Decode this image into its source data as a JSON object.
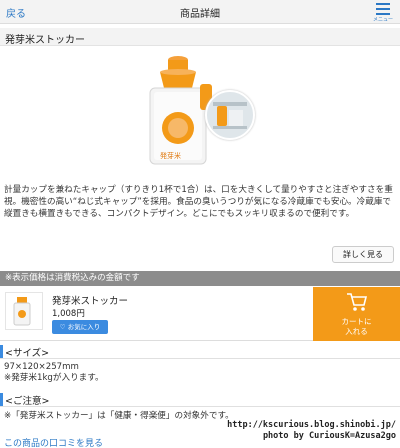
{
  "header": {
    "back_label": "戻る",
    "title": "商品詳細",
    "menu_label": "メニュー"
  },
  "product": {
    "name": "発芽米ストッカー",
    "description": "計量カップを兼ねたキャップ（すりきり1杯で1合）は、口を大きくして量りやすさと注ぎやすさを重視。機密性の高い“ねじ式キャップ”を採用。食品の臭いうつりが気になる冷蔵庫でも安心。冷蔵庫で縦置きも横置きもできる、コンパクトデザイン。どこにでもスッキリ収まるので便利です。",
    "more_label": "詳しく見る",
    "price": "1,008円",
    "package_text": "発芽米"
  },
  "tax_notice": "※表示価格は消費税込みの金額です",
  "actions": {
    "favorite_label": "お気に入り",
    "cart_label_line1": "カートに",
    "cart_label_line2": "入れる"
  },
  "size_section": {
    "heading": "<サイズ>",
    "line1": "97×120×257mm",
    "line2": "※発芽米1kgが入ります。"
  },
  "notes_section": {
    "heading": "<ご注意>",
    "line1": "※「発芽米ストッカー」は「健康・得楽便」の対象外です。"
  },
  "reviews_link": "この商品の口コミを見る",
  "watermark": {
    "line1": "http://kscurious.blog.shinobi.jp/",
    "line2": "photo by CuriousK=Azusa2go"
  },
  "colors": {
    "accent_orange": "#f39a18",
    "link_blue": "#2b78c5",
    "button_blue": "#3b8be0"
  }
}
